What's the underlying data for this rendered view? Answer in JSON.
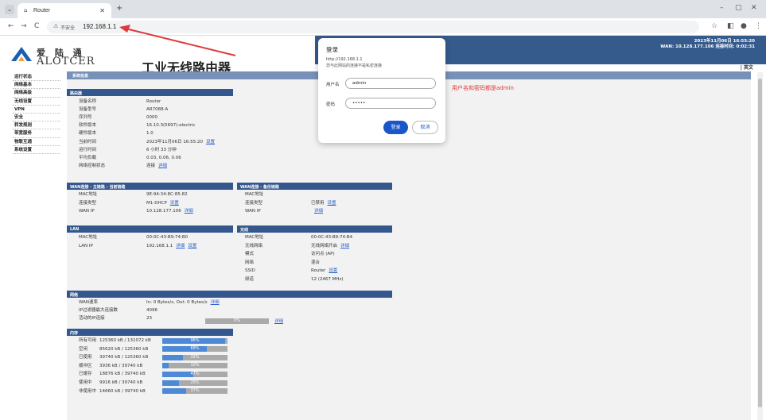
{
  "browser": {
    "tab_title": "Router",
    "new_tab": "+",
    "minimize": "–",
    "restore": "▢",
    "close": "✕",
    "back": "←",
    "forward": "→",
    "reload": "C",
    "insecure_label": "不安全",
    "url": "192.168.1.1"
  },
  "header": {
    "logo_cn": "爱 陆 通",
    "logo_en": "ALOTCER",
    "title": "工业无线路由器",
    "datetime": "2023年11月06日 16:55:20",
    "wan_info": "WAN: 10.128.177.106  连接时间: 0:02:31",
    "lang": "| 英文"
  },
  "sidebar": {
    "items": [
      "运行状态",
      "网络基本",
      "网络高级",
      "无线设置",
      "VPN",
      "安全",
      "转发规则",
      "带宽服务",
      "物联互通",
      "系统设置"
    ]
  },
  "content": {
    "header": "系统信息",
    "router": {
      "title": "路由器",
      "rows": [
        {
          "k": "设备名称",
          "v": "Router",
          "link": ""
        },
        {
          "k": "设备型号",
          "v": "AR7088-A",
          "link": ""
        },
        {
          "k": "序列号",
          "v": "0000",
          "link": ""
        },
        {
          "k": "软件版本",
          "v": "16.10.3(5697)-electric",
          "link": ""
        },
        {
          "k": "硬件版本",
          "v": "1.0",
          "link": ""
        },
        {
          "k": "当前时间",
          "v": "2023年11月06日 16:55:20",
          "link": "设置"
        },
        {
          "k": "运行时间",
          "v": "6 小时 33 分钟",
          "link": ""
        },
        {
          "k": "平均负载",
          "v": "0.03, 0.06, 0.06",
          "link": ""
        },
        {
          "k": "网络控制状态",
          "v": "连接",
          "link": "详细"
        }
      ]
    },
    "wan_main": {
      "title": "WAN连接 - 主链路 - 当前链路",
      "rows": [
        {
          "k": "MAC地址",
          "v": "9E:94:34:8C:85:82",
          "link": ""
        },
        {
          "k": "连接类型",
          "v": "M1-DHCP",
          "link": "设置"
        },
        {
          "k": "WAN IP",
          "v": "10.128.177.106",
          "link": "详细"
        }
      ]
    },
    "wan_backup": {
      "title": "WAN连接 - 备份链路",
      "rows": [
        {
          "k": "MAC地址",
          "v": "",
          "link": ""
        },
        {
          "k": "连接类型",
          "v": "已禁用",
          "link": "设置"
        },
        {
          "k": "WAN IP",
          "v": "",
          "link": "详细"
        }
      ]
    },
    "lan": {
      "title": "LAN",
      "rows": [
        {
          "k": "MAC地址",
          "v": "00:0C:43:B9:74:B0",
          "link": ""
        },
        {
          "k": "LAN IP",
          "v": "192.168.1.1",
          "link": "详细",
          "link2": "设置"
        }
      ]
    },
    "wireless": {
      "title": "无线",
      "rows": [
        {
          "k": "MAC地址",
          "v": "00:0C:43:B9:74:B4",
          "link": ""
        },
        {
          "k": "无线网络",
          "v": "无线网络开启",
          "link": "详细"
        },
        {
          "k": "模式",
          "v": "访问点 (AP)",
          "link": ""
        },
        {
          "k": "网络",
          "v": "混合",
          "link": ""
        },
        {
          "k": "SSID",
          "v": "Router",
          "link": "设置"
        },
        {
          "k": "频道",
          "v": "12 (2467 MHz)",
          "link": ""
        }
      ]
    },
    "network": {
      "title": "网络",
      "rows": [
        {
          "k": "WAN速率",
          "v": "In: 0 Bytes/s, Out: 0 Bytes/s",
          "link": "详细"
        },
        {
          "k": "IP过滤器最大连接数",
          "v": "4096",
          "link": ""
        },
        {
          "k": "活动的IP连接",
          "v": "23",
          "link": ""
        }
      ],
      "conn_bar": {
        "percent": 0,
        "label": "0%",
        "link": "详细"
      }
    },
    "memory": {
      "title": "内存",
      "rows": [
        {
          "k": "所有可用",
          "v": "125360 kB / 131072 kB",
          "percent": 96,
          "label": "96%"
        },
        {
          "k": "空闲",
          "v": "85620 kB / 125360 kB",
          "percent": 68,
          "label": "68%"
        },
        {
          "k": "已使用",
          "v": "39740 kB / 125360 kB",
          "percent": 32,
          "label": "32%"
        },
        {
          "k": "缓冲区",
          "v": "3936 kB / 39740 kB",
          "percent": 10,
          "label": "10%"
        },
        {
          "k": "已缓存",
          "v": "18876 kB / 39740 kB",
          "percent": 47,
          "label": "47%"
        },
        {
          "k": "使用中",
          "v": "9916 kB / 39740 kB",
          "percent": 25,
          "label": "25%"
        },
        {
          "k": "非使用中",
          "v": "14660 kB / 39740 kB",
          "percent": 37,
          "label": "37%"
        }
      ]
    }
  },
  "dialog": {
    "title": "登录",
    "url": "http://192.168.1.1",
    "note": "您与此网站的连接不是私密连接",
    "username_label": "用户名",
    "username_value": "admin",
    "password_label": "密码",
    "password_value": "•••••",
    "login_button": "登录",
    "cancel_button": "取消"
  },
  "annotation": {
    "note": "用户名和密码都是admin",
    "color": "#e0393c"
  },
  "colors": {
    "banner": "#355a8c",
    "section": "#34588e",
    "bar_fill": "#4c89d6",
    "link": "#2b62c9"
  }
}
